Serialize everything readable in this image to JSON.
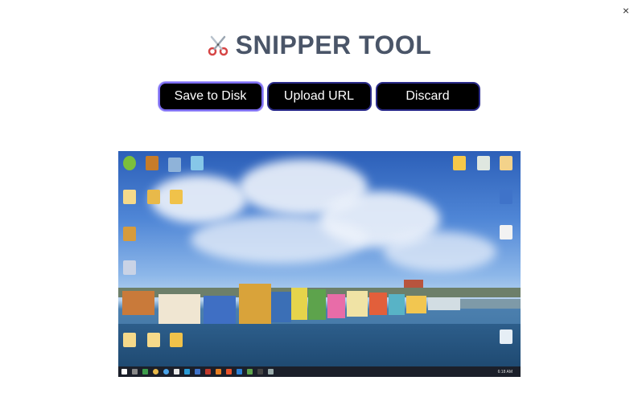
{
  "window": {
    "close_label": "×"
  },
  "header": {
    "title": "SNIPPER TOOL",
    "icon": "scissors-icon"
  },
  "actions": {
    "save_label": "Save to Disk",
    "upload_label": "Upload URL",
    "discard_label": "Discard"
  },
  "preview": {
    "description_icon": "desktop-screenshot-preview",
    "taskbar_time": "6:18 AM",
    "taskbar_date": "14/06/2020",
    "taskbar_lang": "ENG"
  },
  "colors": {
    "title": "#4a5568",
    "button_bg": "#000000",
    "button_text": "#ffffff",
    "button_border": "#2b2b8a",
    "focus_border": "#7c6cf2"
  }
}
